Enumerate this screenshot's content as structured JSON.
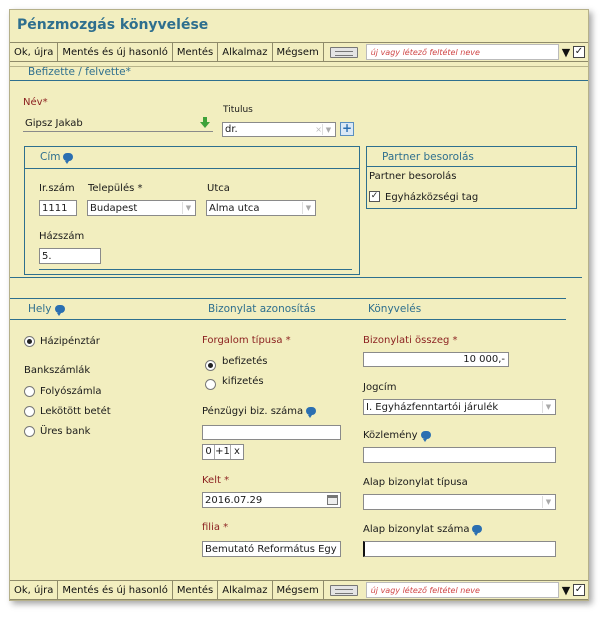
{
  "window": {
    "title": "Pénzmozgás könyvelése"
  },
  "toolbar": {
    "ok_again": "Ok, újra",
    "save_similar": "Mentés és új hasonló",
    "save": "Mentés",
    "apply": "Alkalmaz",
    "cancel": "Mégsem",
    "condition_placeholder": "új vagy létező feltétel neve",
    "dropdown_glyph": "▼",
    "check_glyph": "✓"
  },
  "paid_section": {
    "title": "Befizette / felvette*"
  },
  "name": {
    "label": "Név",
    "required_mark": "*",
    "value": "Gipsz Jakab"
  },
  "titulus": {
    "label": "Titulus",
    "value": "dr."
  },
  "address": {
    "title": "Cím",
    "zip_label": "Ir.szám",
    "zip_value": "1111",
    "city_label": "Település",
    "city_required": "*",
    "city_value": "Budapest",
    "street_label": "Utca",
    "street_value": "Alma utca",
    "house_label": "Házszám",
    "house_value": "5."
  },
  "partner": {
    "title": "Partner besorolás",
    "sub_label": "Partner besorolás",
    "member_label": "Egyházközségi tag",
    "member_checked": true,
    "check_glyph": "✓"
  },
  "place": {
    "title": "Hely",
    "cash_label": "Házipénztár",
    "bank_accounts_label": "Bankszámlák",
    "current_label": "Folyószámla",
    "fixed_label": "Lekötött betét",
    "empty_bank_label": "Üres bank"
  },
  "document_id": {
    "title": "Bizonylat azonosítás",
    "type_label": "Forgalom típusa",
    "type_required": "*",
    "deposit_label": "befizetés",
    "withdraw_label": "kifizetés",
    "fin_doc_label": "Pénzügyi biz. száma",
    "fin_doc_value": "",
    "counter_zero": "0",
    "counter_plus": "+1",
    "counter_x": "x",
    "date_label": "Kelt",
    "date_required": "*",
    "date_value": "2016.07.29",
    "branch_label": "filia",
    "branch_required": "*",
    "branch_value": "Bemutató Református Egy"
  },
  "booking": {
    "title": "Könyvelés",
    "amount_label": "Bizonylati összeg",
    "amount_required": "*",
    "amount_value": "10 000,-",
    "jogcim_label": "Jogcím",
    "jogcim_value": "I. Egyházfenntartói járulék",
    "comment_label": "Közlemény",
    "comment_value": "",
    "base_type_label": "Alap bizonylat típusa",
    "base_type_value": "",
    "base_number_label": "Alap bizonylat száma",
    "base_number_value": ""
  },
  "colors": {
    "accent": "#2e6f8e",
    "required": "#8b1f1f",
    "background": "#f2eebf",
    "placeholder_red": "#d04646"
  }
}
